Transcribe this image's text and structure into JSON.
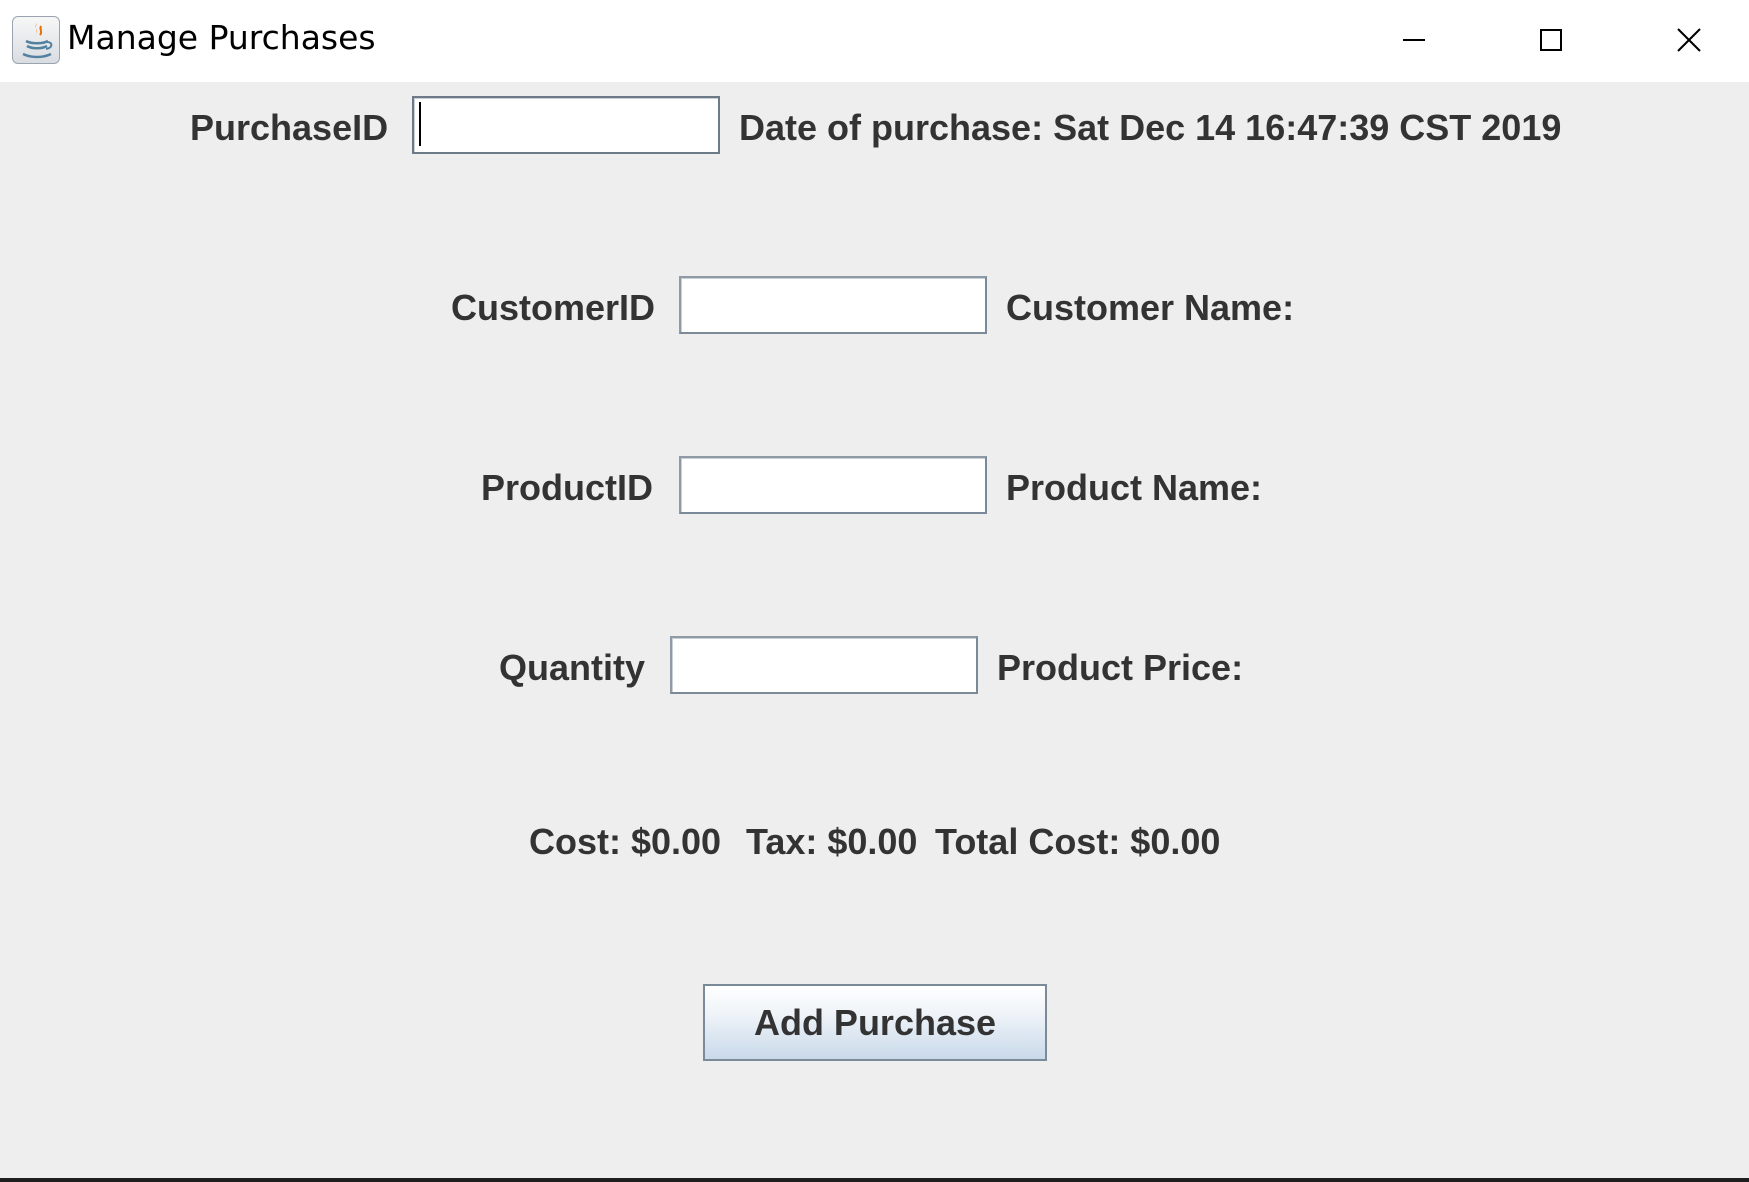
{
  "window": {
    "title": "Manage Purchases",
    "icon": "java-cup-icon",
    "controls": [
      "minimize-icon",
      "maximize-icon",
      "close-icon"
    ]
  },
  "form": {
    "purchase_id_label": "PurchaseID",
    "purchase_id_value": "",
    "date_label": "Date of purchase: Sat Dec 14 16:47:39 CST 2019",
    "customer_id_label": "CustomerID",
    "customer_id_value": "",
    "customer_name_label": "Customer Name:",
    "product_id_label": "ProductID",
    "product_id_value": "",
    "product_name_label": "Product Name:",
    "quantity_label": "Quantity",
    "quantity_value": "",
    "product_price_label": "Product Price:"
  },
  "totals": {
    "cost": "Cost: $0.00",
    "tax": "Tax: $0.00",
    "total": "Total Cost: $0.00"
  },
  "actions": {
    "add_purchase_label": "Add Purchase"
  },
  "colors": {
    "background": "#eeeeee",
    "text": "#333333",
    "button_gradient_bottom": "#c9d9ea"
  }
}
